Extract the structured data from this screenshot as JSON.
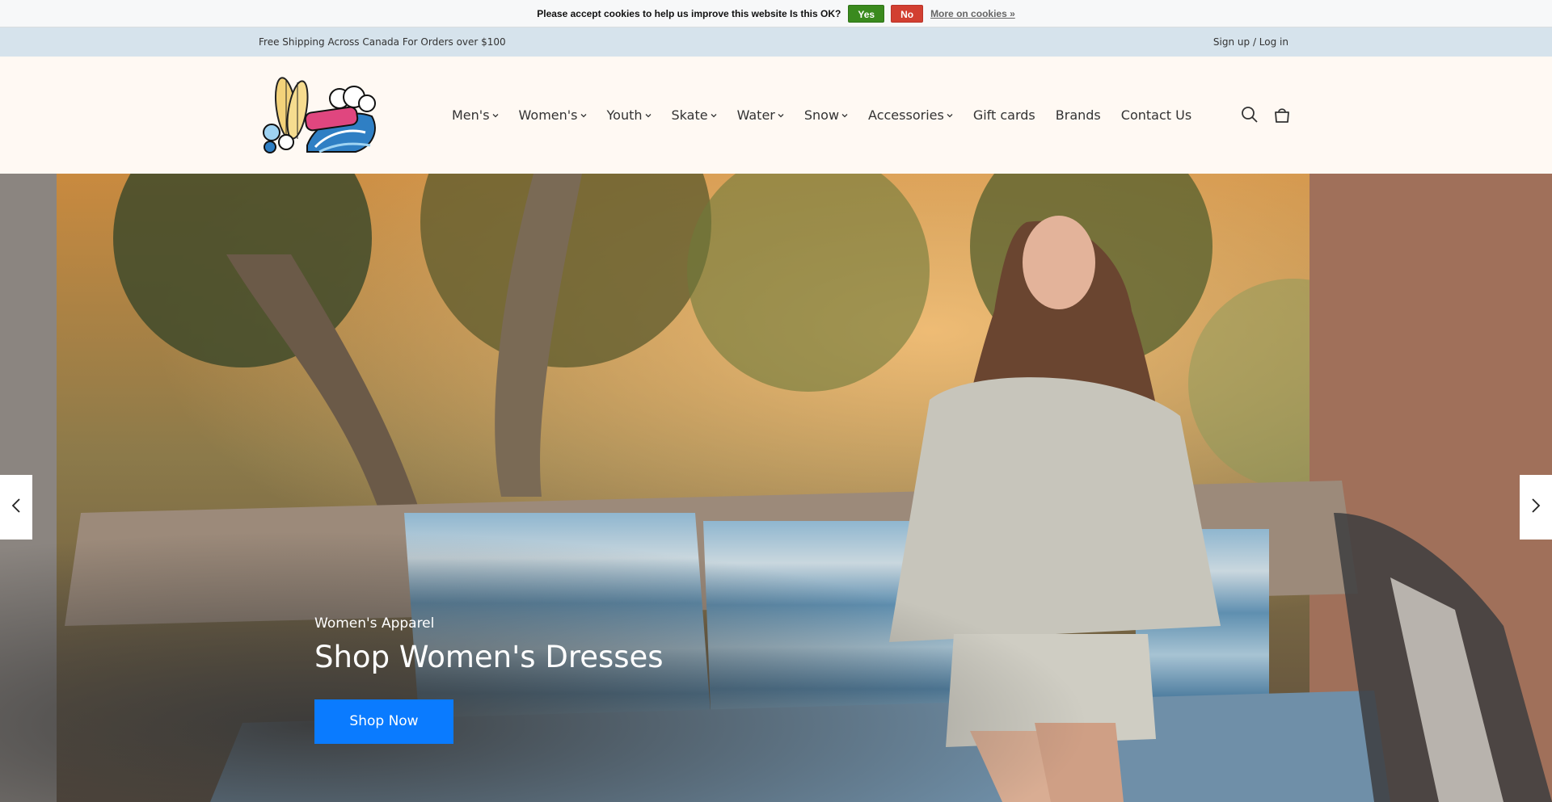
{
  "cookie_bar": {
    "message": "Please accept cookies to help us improve this website Is this OK?",
    "yes_label": "Yes",
    "no_label": "No",
    "more_label": "More on cookies »"
  },
  "announcement": {
    "text": "Free Shipping Across Canada For Orders over $100",
    "account_link": "Sign up / Log in"
  },
  "header": {
    "logo_alt": "Kahuna Surf Shop",
    "nav": [
      {
        "label": "Men's",
        "dropdown": true
      },
      {
        "label": "Women's",
        "dropdown": true
      },
      {
        "label": "Youth",
        "dropdown": true
      },
      {
        "label": "Skate",
        "dropdown": true
      },
      {
        "label": "Water",
        "dropdown": true
      },
      {
        "label": "Snow",
        "dropdown": true
      },
      {
        "label": "Accessories",
        "dropdown": true
      },
      {
        "label": "Gift cards",
        "dropdown": false
      },
      {
        "label": "Brands",
        "dropdown": false
      },
      {
        "label": "Contact Us",
        "dropdown": false
      }
    ],
    "icons": [
      "search-icon",
      "cart-icon"
    ]
  },
  "hero": {
    "subtitle": "Women's Apparel",
    "title": "Shop Women's Dresses",
    "button_label": "Shop Now",
    "button_color": "#0a7bff"
  },
  "colors": {
    "announcement_bg": "#d6e3ec",
    "header_bg": "#fff9f3",
    "cookie_yes": "#3a8a1e",
    "cookie_no": "#d23f31"
  }
}
